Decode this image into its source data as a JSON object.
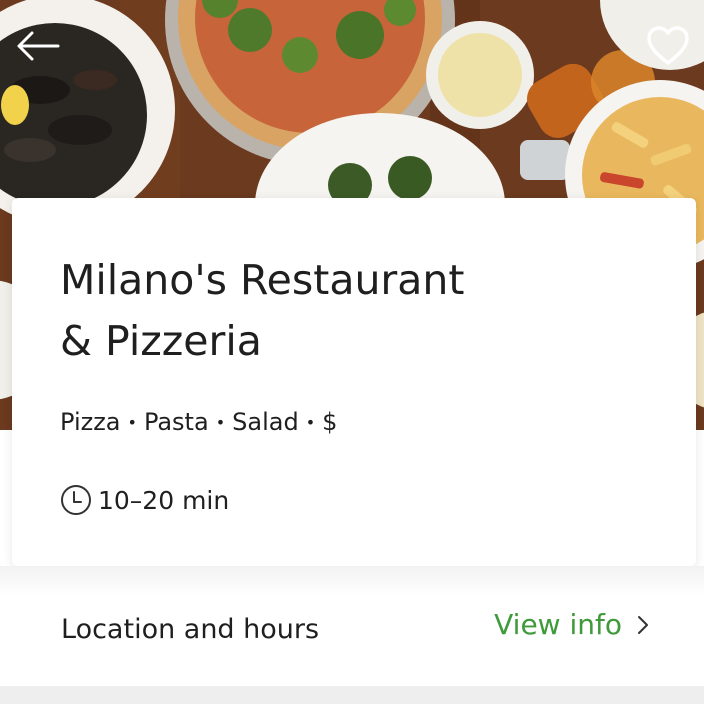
{
  "restaurant": {
    "title_line1": "Milano's Restaurant",
    "title_line2": "& Pizzeria",
    "categories": [
      "Pizza",
      "Pasta",
      "Salad",
      "$"
    ],
    "separator": "•",
    "delivery_time": "10–20 min"
  },
  "location_section": {
    "label": "Location and hours",
    "action_label": "View info"
  },
  "icons": {
    "back": "arrow-left-icon",
    "favorite": "heart-outline-icon",
    "clock": "clock-icon",
    "chevron": "chevron-right-icon"
  },
  "colors": {
    "accent_green": "#3f9a3a",
    "text": "#1f1f1f",
    "card": "#ffffff"
  }
}
